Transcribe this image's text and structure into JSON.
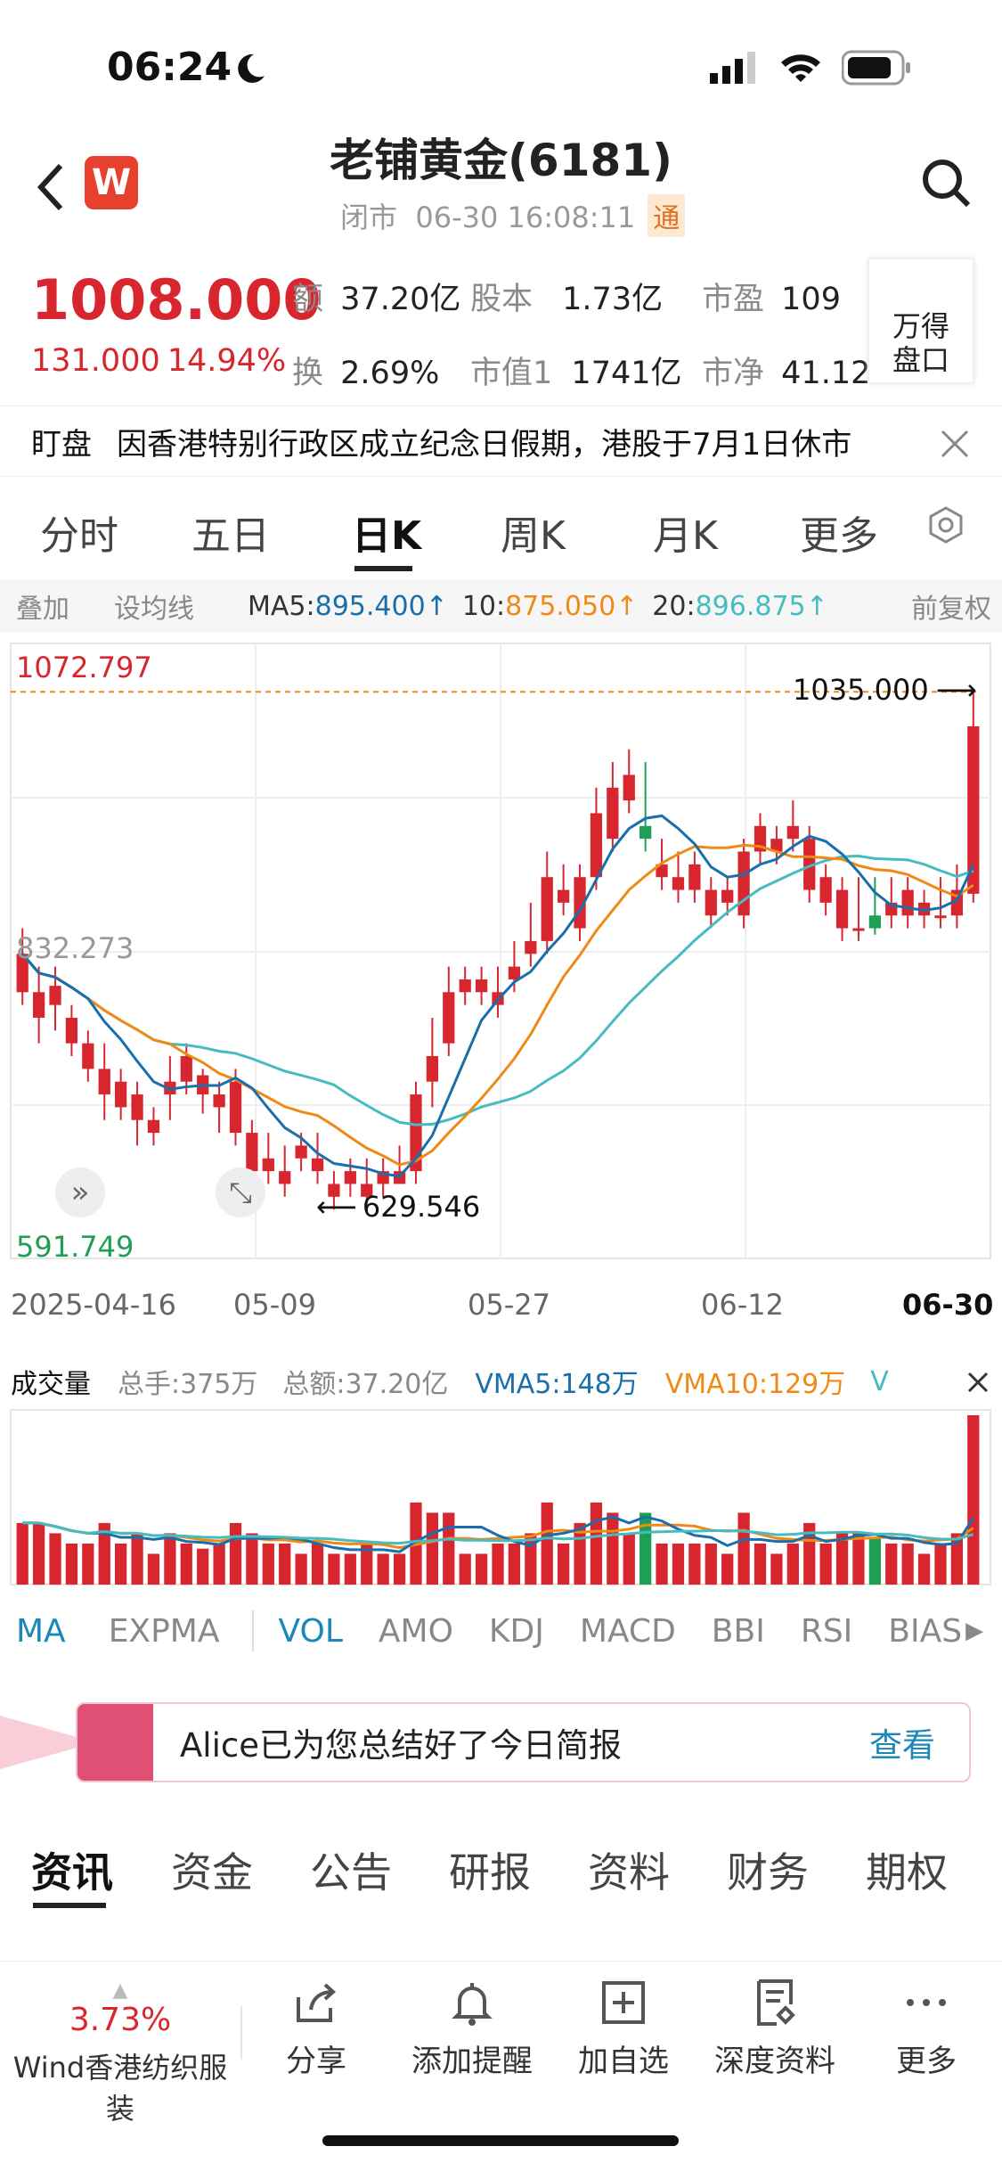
{
  "status": {
    "time": "06:24"
  },
  "header": {
    "title": "老铺黄金(6181)",
    "subtitle": "闭市  06-30 16:08:11",
    "badge": "通",
    "logo": "W"
  },
  "quote": {
    "price": "1008.000",
    "change": "131.000",
    "pct": "14.94%",
    "items": [
      {
        "label": "额",
        "value": "37.20亿"
      },
      {
        "label": "股本",
        "value": "1.73亿"
      },
      {
        "label": "市盈",
        "value": "109"
      },
      {
        "label": "换",
        "value": "2.69%"
      },
      {
        "label": "市值1",
        "value": "1741亿"
      },
      {
        "label": "市净",
        "value": "41.12"
      }
    ],
    "panel": "万得\n盘口"
  },
  "banner": {
    "tag": "盯盘",
    "text": "因香港特别行政区成立纪念日假期，港股于7月1日休市"
  },
  "tabs": [
    "分时",
    "五日",
    "日K",
    "周K",
    "月K",
    "更多"
  ],
  "overlay": {
    "a": "叠加",
    "b": "设均线",
    "ma5": "MA5:",
    "ma5v": "895.400↑",
    "ma10": "10:",
    "ma10v": "875.050↑",
    "ma20": "20:",
    "ma20v": "896.875↑",
    "right": "前复权"
  },
  "chart_data": {
    "type": "candlestick",
    "ymax_label": "1072.797",
    "ymid_label": "832.273",
    "ymin_label": "591.749",
    "ylim": [
      591.749,
      1072.797
    ],
    "high_annot": "1035.000",
    "low_annot": "629.546",
    "xlabels": [
      "2025-04-16",
      "05-09",
      "05-27",
      "06-12",
      "06-30"
    ],
    "candles": [
      [
        830,
        850,
        800,
        790
      ],
      [
        800,
        820,
        780,
        760
      ],
      [
        805,
        820,
        790,
        770
      ],
      [
        780,
        790,
        760,
        750
      ],
      [
        760,
        770,
        740,
        730
      ],
      [
        740,
        760,
        720,
        700
      ],
      [
        730,
        740,
        710,
        700
      ],
      [
        720,
        730,
        700,
        680
      ],
      [
        700,
        710,
        690,
        680
      ],
      [
        730,
        750,
        720,
        700
      ],
      [
        750,
        760,
        730,
        720
      ],
      [
        735,
        740,
        720,
        705
      ],
      [
        720,
        730,
        710,
        690
      ],
      [
        730,
        740,
        690,
        680
      ],
      [
        690,
        700,
        660,
        650
      ],
      [
        670,
        690,
        660,
        650
      ],
      [
        660,
        680,
        650,
        640
      ],
      [
        680,
        690,
        670,
        660
      ],
      [
        670,
        690,
        660,
        650
      ],
      [
        650,
        660,
        640,
        630
      ],
      [
        660,
        670,
        650,
        640
      ],
      [
        650,
        670,
        640,
        630
      ],
      [
        660,
        670,
        650,
        640
      ],
      [
        660,
        680,
        650,
        650
      ],
      [
        720,
        730,
        660,
        650
      ],
      [
        750,
        780,
        730,
        710
      ],
      [
        800,
        820,
        760,
        750
      ],
      [
        810,
        820,
        800,
        790
      ],
      [
        810,
        820,
        800,
        790
      ],
      [
        800,
        820,
        790,
        780
      ],
      [
        820,
        840,
        810,
        800
      ],
      [
        840,
        870,
        830,
        820
      ],
      [
        890,
        910,
        840,
        830
      ],
      [
        880,
        900,
        870,
        860
      ],
      [
        890,
        900,
        850,
        840
      ],
      [
        940,
        960,
        890,
        880
      ],
      [
        960,
        980,
        920,
        910
      ],
      [
        970,
        990,
        950,
        940
      ],
      [
        920,
        980,
        930,
        910
      ],
      [
        900,
        920,
        890,
        880
      ],
      [
        890,
        910,
        880,
        870
      ],
      [
        900,
        910,
        880,
        870
      ],
      [
        880,
        890,
        860,
        850
      ],
      [
        880,
        890,
        870,
        860
      ],
      [
        910,
        920,
        860,
        850
      ],
      [
        930,
        940,
        910,
        900
      ],
      [
        920,
        930,
        910,
        900
      ],
      [
        930,
        950,
        920,
        910
      ],
      [
        920,
        930,
        880,
        870
      ],
      [
        890,
        900,
        870,
        860
      ],
      [
        880,
        890,
        850,
        840
      ],
      [
        850,
        890,
        850,
        840
      ],
      [
        850,
        890,
        860,
        845
      ],
      [
        870,
        890,
        860,
        850
      ],
      [
        880,
        890,
        860,
        850
      ],
      [
        870,
        880,
        860,
        850
      ],
      [
        860,
        890,
        860,
        850
      ],
      [
        880,
        900,
        860,
        850
      ],
      [
        1008,
        1035,
        877,
        870
      ]
    ]
  },
  "vol": {
    "label": "成交量",
    "a": "总手:375万",
    "b": "总额:37.20亿",
    "c": "VMA5:148万",
    "d": "VMA10:129万",
    "e": "V"
  },
  "indicators": [
    "MA",
    "EXPMA",
    "VOL",
    "AMO",
    "KDJ",
    "MACD",
    "BBI",
    "RSI",
    "BIAS"
  ],
  "alice": {
    "text": "Alice已为您总结好了今日简报",
    "link": "查看"
  },
  "news": [
    "资讯",
    "资金",
    "公告",
    "研报",
    "资料",
    "财务",
    "期权"
  ],
  "bottom": {
    "pct": "3.73%",
    "sector": "Wind香港纺织服装",
    "items": [
      "分享",
      "添加提醒",
      "加自选",
      "深度资料",
      "更多"
    ]
  }
}
